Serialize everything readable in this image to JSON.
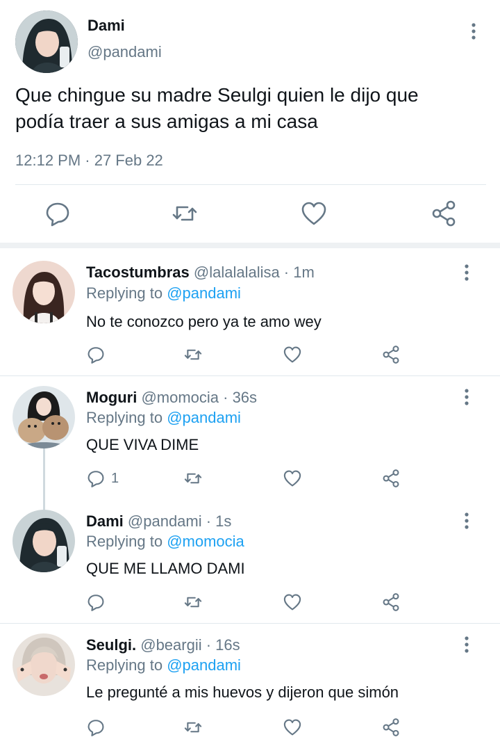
{
  "main_tweet": {
    "name": "Dami",
    "handle": "@pandami",
    "text_line1": "Que chingue su madre Seulgi quien le dijo que",
    "text_line2": "podía traer a sus amigas a mi casa",
    "timestamp": "12:12 PM · 27 Feb 22",
    "actions": [
      "reply-icon",
      "retweet-icon",
      "like-icon",
      "share-icon"
    ]
  },
  "replies": [
    {
      "name": "Tacostumbras",
      "meta": " @lalalalalisa · 1m",
      "replying_label": "Replying to ",
      "replying_to": "@pandami",
      "text": "No te conozco pero ya te amo wey",
      "reply_count": ""
    },
    {
      "name": "Moguri",
      "meta": " @momocia · 36s",
      "replying_label": "Replying to ",
      "replying_to": "@pandami",
      "text": "QUE VIVA DIME",
      "reply_count": "1"
    },
    {
      "name": "Dami",
      "meta": " @pandami · 1s",
      "replying_label": "Replying to ",
      "replying_to": "@momocia",
      "text": "QUE ME LLAMO DAMI",
      "reply_count": ""
    },
    {
      "name": "Seulgi.",
      "meta": " @beargii · 16s",
      "replying_label": "Replying to ",
      "replying_to": "@pandami",
      "text": "Le pregunté a mis huevos y dijeron que simón",
      "reply_count": ""
    }
  ],
  "colors": {
    "text": "#0f1419",
    "secondary": "#657786",
    "link": "#1da1f2",
    "divider": "#e1e8ed"
  }
}
